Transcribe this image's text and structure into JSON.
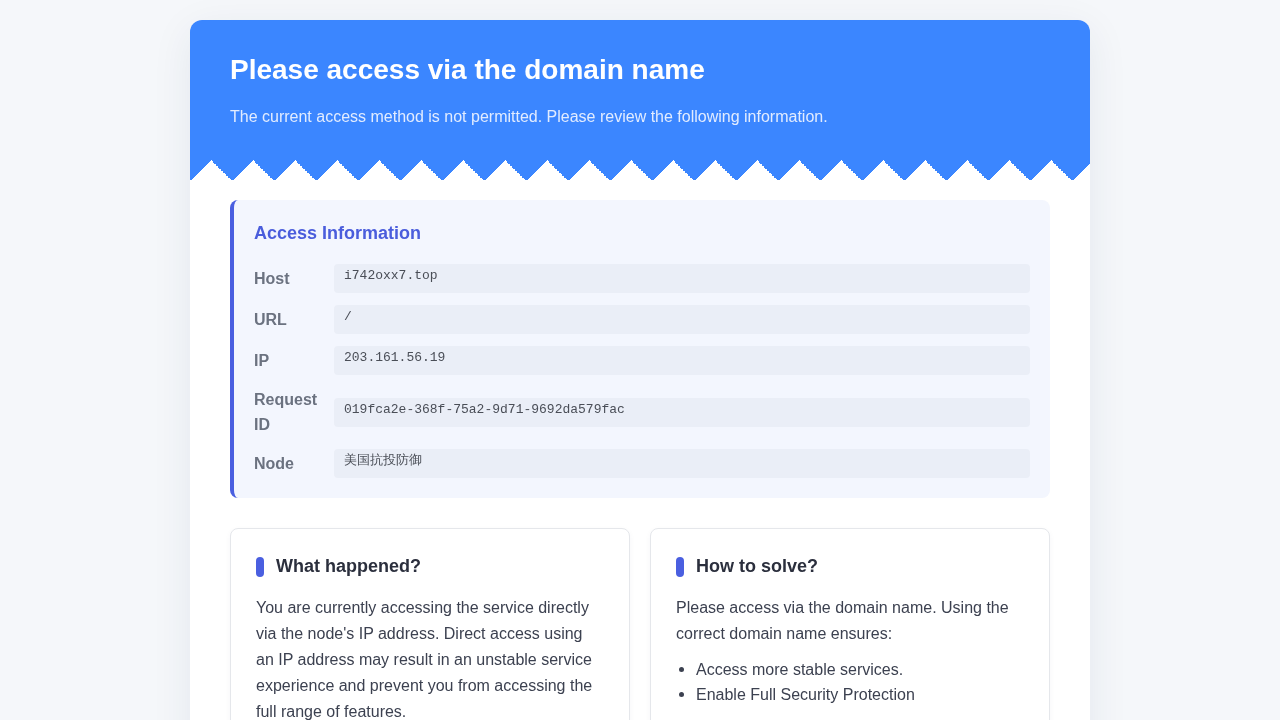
{
  "header": {
    "title": "Please access via the domain name",
    "subtitle": "The current access method is not permitted. Please review the following information."
  },
  "access_info": {
    "title": "Access Information",
    "rows": [
      {
        "label": "Host",
        "value": "i742oxx7.top"
      },
      {
        "label": "URL",
        "value": "/"
      },
      {
        "label": "IP",
        "value": "203.161.56.19"
      },
      {
        "label": "Request ID",
        "value": "019fca2e-368f-75a2-9d71-9692da579fac"
      },
      {
        "label": "Node",
        "value": "美国抗投防御"
      }
    ]
  },
  "cards": [
    {
      "title": "What happened?",
      "paragraph": "You are currently accessing the service directly via the node's IP address. Direct access using an IP address may result in an unstable service experience and prevent you from accessing the full range of features."
    },
    {
      "title": "How to solve?",
      "paragraph": "Please access via the domain name. Using the correct domain name ensures:",
      "items": [
        "Access more stable services.",
        "Enable Full Security Protection"
      ]
    }
  ]
}
